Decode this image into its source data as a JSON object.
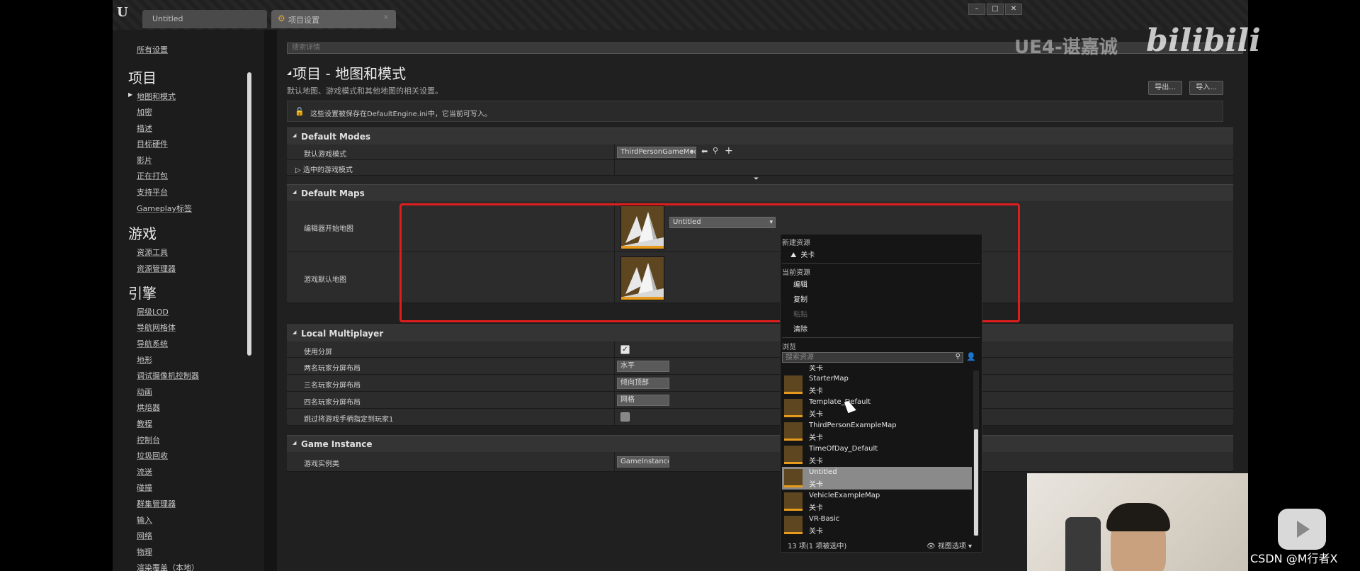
{
  "tabs": [
    {
      "label": "Untitled"
    },
    {
      "label": "项目设置"
    }
  ],
  "window_controls": [
    "–",
    "□",
    "✕"
  ],
  "sidebar": {
    "all_settings": "所有设置",
    "groups": [
      {
        "title": "项目",
        "items": [
          "地图和模式",
          "加密",
          "描述",
          "目标硬件",
          "影片",
          "正在打包",
          "支持平台",
          "Gameplay标签"
        ]
      },
      {
        "title": "游戏",
        "items": [
          "资源工具",
          "资源管理器"
        ]
      },
      {
        "title": "引擎",
        "items": [
          "层级LOD",
          "导航网格体",
          "导航系统",
          "地形",
          "调试摄像机控制器",
          "动画",
          "烘焙器",
          "教程",
          "控制台",
          "垃圾回收",
          "流送",
          "碰撞",
          "群集管理器",
          "输入",
          "网络",
          "物理",
          "渲染覆盖（本地）"
        ]
      }
    ],
    "current_item": "地图和模式"
  },
  "main": {
    "search_placeholder": "搜索详情",
    "title": "项目 - 地图和模式",
    "subtitle": "默认地图、游戏模式和其他地图的相关设置。",
    "export_label": "导出...",
    "import_label": "导入...",
    "notice": "这些设置被保存在DefaultEngine.ini中，它当前可写入。"
  },
  "sections": {
    "default_modes": {
      "title": "Default Modes",
      "default_game_mode_label": "默认游戏模式",
      "default_game_mode_value": "ThirdPersonGameMode",
      "selected_game_mode_label": "选中的游戏模式"
    },
    "default_maps": {
      "title": "Default Maps",
      "editor_startup_map_label": "编辑器开始地图",
      "editor_startup_map_value": "Untitled",
      "game_default_map_label": "游戏默认地图"
    },
    "local_multiplayer": {
      "title": "Local Multiplayer",
      "use_splitscreen_label": "使用分屏",
      "use_splitscreen": true,
      "two_player_label": "两名玩家分屏布局",
      "two_player_value": "水平",
      "three_player_label": "三名玩家分屏布局",
      "three_player_value": "倾向顶部",
      "four_player_label": "四名玩家分屏布局",
      "four_player_value": "网格",
      "skip_assign_label": "跳过将游戏手柄指定到玩家1",
      "skip_assign": false
    },
    "game_instance": {
      "title": "Game Instance",
      "class_label": "游戏实例类",
      "class_value": "GameInstance"
    }
  },
  "dropdown": {
    "new_asset_header": "新建资源",
    "new_level": "关卡",
    "current_asset_header": "当前资源",
    "edit": "编辑",
    "copy": "复制",
    "paste": "粘贴",
    "clear": "清除",
    "browse_header": "浏览",
    "search_placeholder": "搜索资源",
    "partial_item_type": "关卡",
    "assets": [
      {
        "name": "StarterMap",
        "type": "关卡",
        "selected": false
      },
      {
        "name": "Template_Default",
        "type": "关卡",
        "selected": false
      },
      {
        "name": "ThirdPersonExampleMap",
        "type": "关卡",
        "selected": false
      },
      {
        "name": "TimeOfDay_Default",
        "type": "关卡",
        "selected": false
      },
      {
        "name": "Untitled",
        "type": "关卡",
        "selected": true
      },
      {
        "name": "VehicleExampleMap",
        "type": "关卡",
        "selected": false
      },
      {
        "name": "VR-Basic",
        "type": "关卡",
        "selected": false
      }
    ],
    "count_text": "13 项(1 项被选中)",
    "view_options": "视图选项"
  },
  "overlays": {
    "watermark": "UE4-谌嘉诚",
    "platform_logo": "bilibili",
    "credit": "CSDN @M行者X"
  },
  "colors": {
    "highlight_box": "#e01d1d",
    "thumbnail_accent": "#e79b1d"
  }
}
